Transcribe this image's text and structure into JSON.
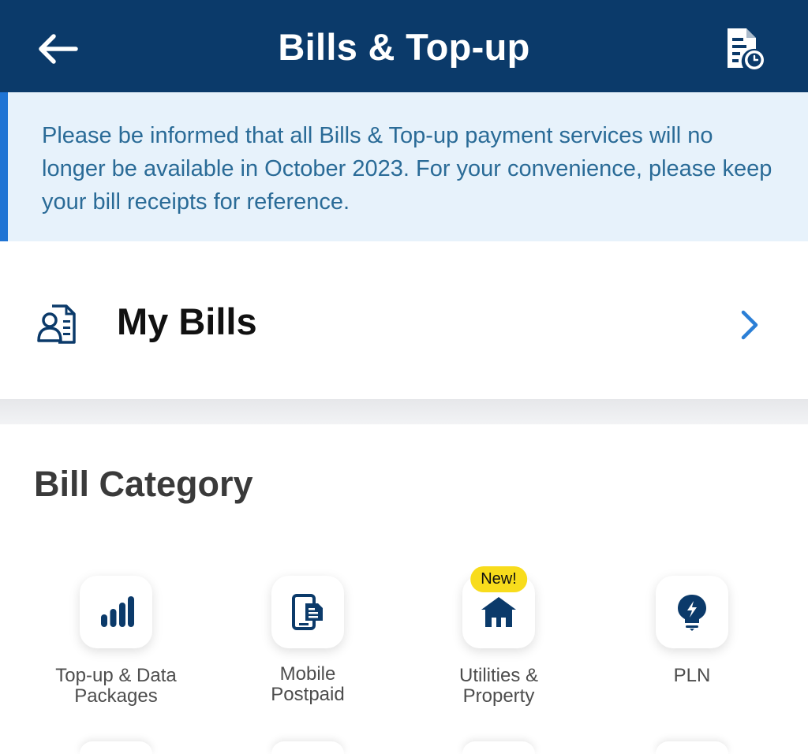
{
  "header": {
    "title": "Bills & Top-up",
    "back_icon": "arrow-left-icon",
    "history_icon": "receipt-history-icon",
    "background_color": "#0b3a6a"
  },
  "notice": {
    "text": "Please be informed that all Bills & Top-up payment services will no longer be available in October 2023. For your convenience, please keep your bill receipts for reference.",
    "accent_color": "#1f74d4",
    "background_color": "#e7f2fb"
  },
  "my_bills": {
    "label": "My Bills",
    "icon": "bill-user-icon",
    "chevron_icon": "chevron-right-icon",
    "chevron_color": "#2b7fd6"
  },
  "bill_category": {
    "title": "Bill Category",
    "items": [
      {
        "line1": "Top-up & Data",
        "line2": "Packages",
        "icon": "signal-bars-icon",
        "badge": ""
      },
      {
        "line1": "Mobile",
        "line2": "Postpaid",
        "icon": "mobile-bill-icon",
        "badge": ""
      },
      {
        "line1": "Utilities &",
        "line2": "Property",
        "icon": "house-icon",
        "badge": "New!"
      },
      {
        "line1": "PLN",
        "line2": "",
        "icon": "lightbulb-icon",
        "badge": ""
      }
    ],
    "badge_color": "#f8dc1c",
    "icon_color": "#0b3a6a"
  }
}
